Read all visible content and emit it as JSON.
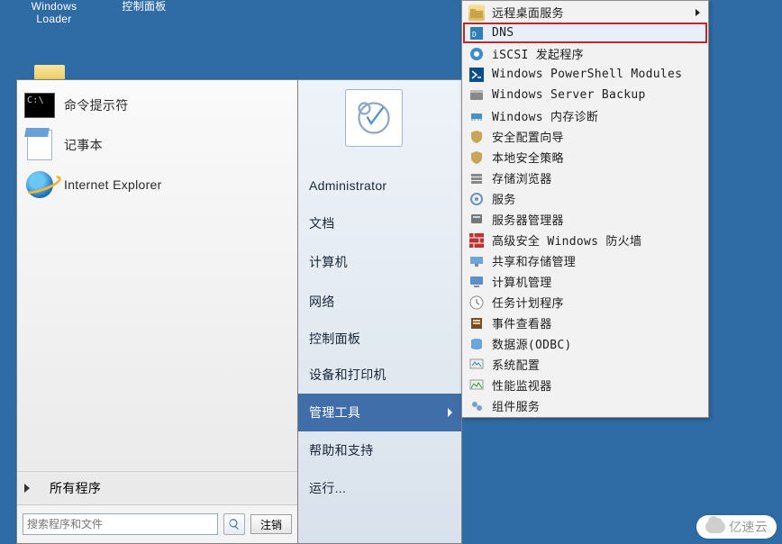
{
  "desktop": {
    "icon_windows_loader": "Windows\nLoader",
    "icon_control_panel": "控制面板"
  },
  "left_panel": {
    "items": [
      {
        "label": "命令提示符"
      },
      {
        "label": "记事本"
      },
      {
        "label": "Internet Explorer"
      }
    ],
    "all_programs": "所有程序",
    "search_placeholder": "搜索程序和文件",
    "shutdown": "注销"
  },
  "mid_panel": {
    "user": "Administrator",
    "items": [
      {
        "label": "文档"
      },
      {
        "label": "计算机"
      },
      {
        "label": "网络"
      },
      {
        "label": "控制面板"
      },
      {
        "label": "设备和打印机"
      },
      {
        "label": "管理工具",
        "highlight": true,
        "hasSub": true
      },
      {
        "label": "帮助和支持"
      },
      {
        "label": "运行..."
      }
    ]
  },
  "sub_panel": {
    "items": [
      {
        "label": "远程桌面服务",
        "icon": "folder",
        "hasSub": true
      },
      {
        "label": "DNS",
        "icon": "dns",
        "highlight": true
      },
      {
        "label": "iSCSI 发起程序",
        "icon": "iscsi"
      },
      {
        "label": "Windows PowerShell Modules",
        "icon": "ps"
      },
      {
        "label": "Windows Server Backup",
        "icon": "backup"
      },
      {
        "label": "Windows 内存诊断",
        "icon": "mem"
      },
      {
        "label": "安全配置向导",
        "icon": "secw"
      },
      {
        "label": "本地安全策略",
        "icon": "secp"
      },
      {
        "label": "存储浏览器",
        "icon": "storage"
      },
      {
        "label": "服务",
        "icon": "services"
      },
      {
        "label": "服务器管理器",
        "icon": "srvmgr"
      },
      {
        "label": "高级安全 Windows 防火墙",
        "icon": "firewall"
      },
      {
        "label": "共享和存储管理",
        "icon": "share"
      },
      {
        "label": "计算机管理",
        "icon": "compmgmt"
      },
      {
        "label": "任务计划程序",
        "icon": "tasksch"
      },
      {
        "label": "事件查看器",
        "icon": "event"
      },
      {
        "label": "数据源(ODBC)",
        "icon": "odbc"
      },
      {
        "label": "系统配置",
        "icon": "msconfig"
      },
      {
        "label": "性能监视器",
        "icon": "perf"
      },
      {
        "label": "组件服务",
        "icon": "comp"
      }
    ]
  },
  "watermark": "亿速云"
}
